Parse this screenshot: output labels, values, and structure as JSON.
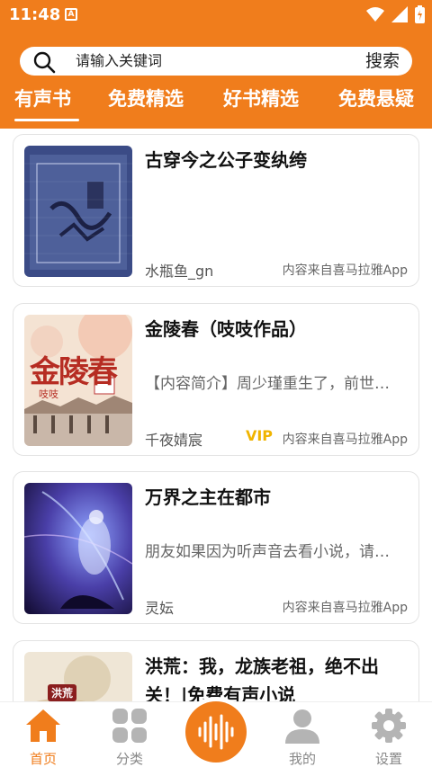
{
  "status": {
    "time": "11:48",
    "notif": "A"
  },
  "search": {
    "placeholder": "请输入关键词",
    "button": "搜索"
  },
  "tabs": [
    {
      "label": "有声书",
      "active": true
    },
    {
      "label": "免费精选"
    },
    {
      "label": "好书精选"
    },
    {
      "label": "免费悬疑"
    }
  ],
  "books": [
    {
      "title": "古穿今之公子变纨绔",
      "desc": "",
      "author": "水瓶鱼_gn",
      "source": "内容来自喜马拉雅App",
      "vip": ""
    },
    {
      "title": "金陵春（吱吱作品）",
      "desc": "【内容简介】周少瑾重生了，前世…",
      "author": "千夜婧宸",
      "source": "内容来自喜马拉雅App",
      "vip": "VIP",
      "cover_text": "金陵春",
      "cover_sub": "吱吱"
    },
    {
      "title": "万界之主在都市",
      "desc": "朋友如果因为听声音去看小说，请…",
      "author": "灵妘",
      "source": "内容来自喜马拉雅App",
      "vip": ""
    },
    {
      "title": "洪荒：我，龙族老祖，绝不出关！|免费有声小说",
      "desc": "",
      "author": "",
      "source": "",
      "vip": "",
      "cover_text": "洪荒"
    }
  ],
  "nav": {
    "home": "首页",
    "category": "分类",
    "mine": "我的",
    "settings": "设置"
  },
  "colors": {
    "brand": "#f07d1c",
    "vip": "#f0b400"
  }
}
